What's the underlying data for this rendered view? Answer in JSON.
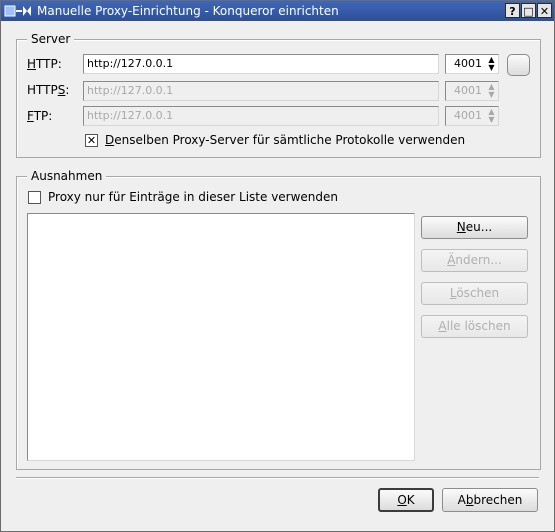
{
  "window": {
    "title": "Manuelle Proxy-Einrichtung - Konqueror einrichten",
    "buttons": {
      "help": "?",
      "maximize": "□",
      "close": "✕"
    }
  },
  "server": {
    "title": "Server",
    "http": {
      "label_u": "H",
      "label_rest": "TTP:",
      "value": "http://127.0.0.1",
      "port": "4001"
    },
    "https": {
      "label_pre": "HTTP",
      "label_u": "S",
      "label_post": ":",
      "value": "http://127.0.0.1",
      "port": "4001"
    },
    "ftp": {
      "label_u": "F",
      "label_rest": "TP:",
      "value": "http://127.0.0.1",
      "port": "4001"
    },
    "same_proxy": {
      "label_u": "D",
      "label_rest": "enselben Proxy-Server für sämtliche Protokolle verwenden",
      "checked": true
    }
  },
  "exceptions": {
    "title": "Ausnahmen",
    "only_list": {
      "label": "Proxy nur für Einträge in dieser Liste verwenden",
      "checked": false
    },
    "items": [],
    "buttons": {
      "new": {
        "u": "N",
        "rest": "eu..."
      },
      "change": {
        "u": "Ä",
        "rest": "ndern..."
      },
      "delete": {
        "u": "L",
        "rest": "öschen"
      },
      "delete_all": {
        "u": "A",
        "rest": "lle löschen"
      }
    }
  },
  "footer": {
    "ok": {
      "u": "O",
      "rest": "K"
    },
    "cancel": {
      "pre": "A",
      "u": "b",
      "rest": "brechen"
    }
  }
}
